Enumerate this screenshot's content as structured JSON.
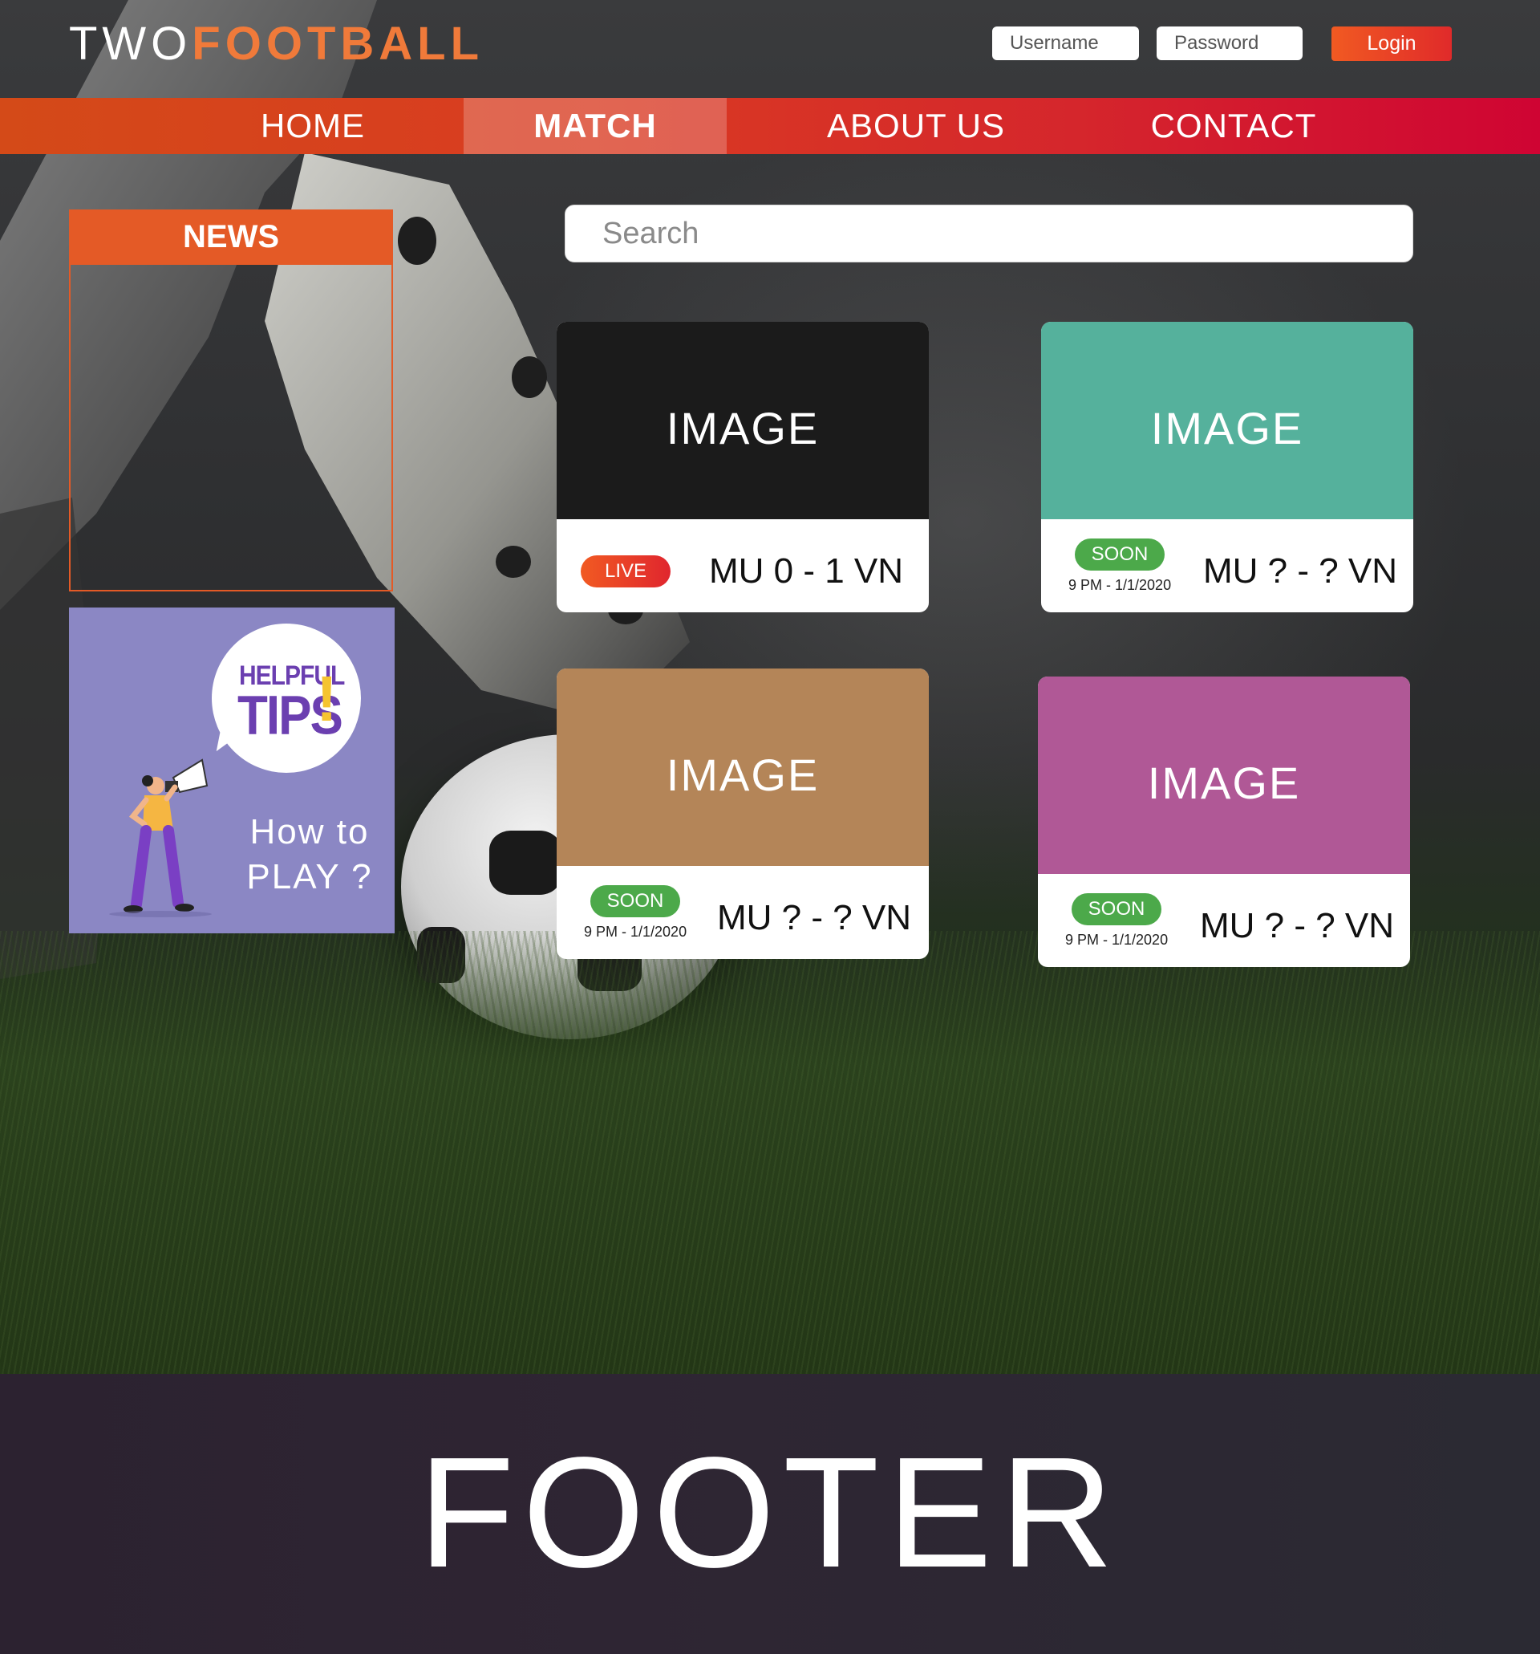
{
  "header": {
    "logo_prefix": "TWO",
    "logo_suffix": "FOOTBALL",
    "username_placeholder": "Username",
    "password_placeholder": "Password",
    "login_label": "Login"
  },
  "nav": {
    "items": [
      {
        "label": "HOME",
        "active": false
      },
      {
        "label": "MATCH",
        "active": true
      },
      {
        "label": "ABOUT US",
        "active": false
      },
      {
        "label": "CONTACT",
        "active": false
      }
    ]
  },
  "sidebar": {
    "news_title": "NEWS",
    "tips": {
      "helpful": "HELPFUL",
      "tips": "TIPS",
      "bang": "!",
      "how_to_line1": "How to",
      "how_to_line2": "PLAY ?"
    }
  },
  "search": {
    "placeholder": "Search"
  },
  "matches": [
    {
      "image_label": "IMAGE",
      "image_color": "#1b1b1b",
      "status": "LIVE",
      "time": "",
      "score": "MU 0 - 1 VN"
    },
    {
      "image_label": "IMAGE",
      "image_color": "#55b19c",
      "status": "SOON",
      "time": "9 PM - 1/1/2020",
      "score": "MU ? - ? VN"
    },
    {
      "image_label": "IMAGE",
      "image_color": "#b48558",
      "status": "SOON",
      "time": "9 PM - 1/1/2020",
      "score": "MU ? - ? VN"
    },
    {
      "image_label": "IMAGE",
      "image_color": "#b05896",
      "status": "SOON",
      "time": "9 PM - 1/1/2020",
      "score": "MU ? - ? VN"
    }
  ],
  "footer": {
    "label": "FOOTER"
  },
  "colors": {
    "brand_orange": "#f07a3a",
    "nav_start": "#d44a18",
    "nav_end": "#cf0433",
    "live": "#e0262e",
    "soon": "#4ca94a",
    "tips_bg": "#8b87c4"
  }
}
